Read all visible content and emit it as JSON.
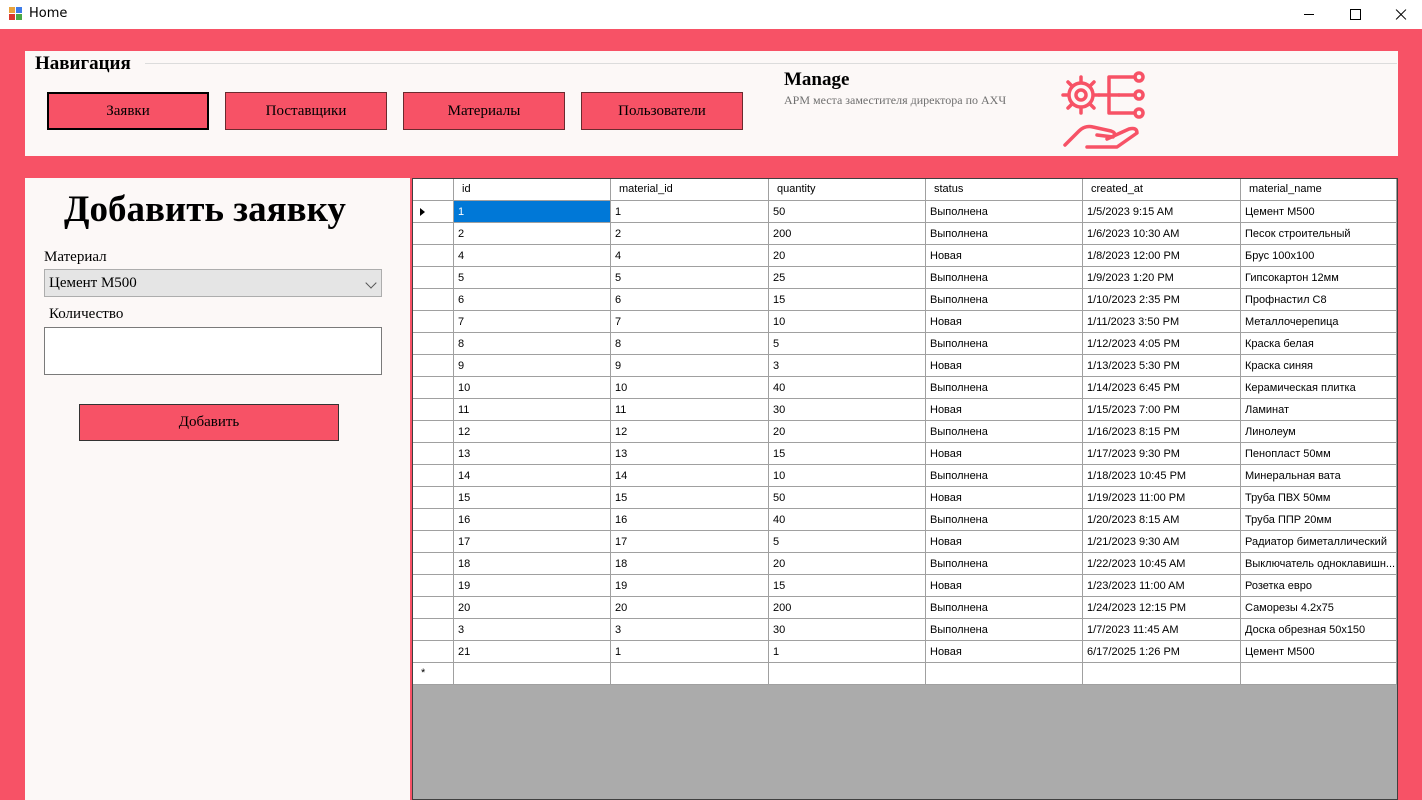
{
  "window": {
    "title": "Home"
  },
  "nav": {
    "legend": "Навигация",
    "buttons": [
      "Заявки",
      "Поставщики",
      "Материалы",
      "Пользователи"
    ]
  },
  "brand": {
    "title": "Manage",
    "subtitle": "АРМ места заместителя директора по АХЧ",
    "logo_icon": "gear-hand-network-icon"
  },
  "form": {
    "title": "Добавить заявку",
    "material_label": "Материал",
    "material_value": "Цемент М500",
    "quantity_label": "Количество",
    "quantity_value": "",
    "submit_label": "Добавить"
  },
  "grid": {
    "columns": [
      "id",
      "material_id",
      "quantity",
      "status",
      "created_at",
      "material_name"
    ],
    "rows": [
      [
        "1",
        "1",
        "50",
        "Выполнена",
        "1/5/2023 9:15 AM",
        "Цемент М500"
      ],
      [
        "2",
        "2",
        "200",
        "Выполнена",
        "1/6/2023 10:30 AM",
        "Песок строительный"
      ],
      [
        "4",
        "4",
        "20",
        "Новая",
        "1/8/2023 12:00 PM",
        "Брус 100х100"
      ],
      [
        "5",
        "5",
        "25",
        "Выполнена",
        "1/9/2023 1:20 PM",
        "Гипсокартон 12мм"
      ],
      [
        "6",
        "6",
        "15",
        "Выполнена",
        "1/10/2023 2:35 PM",
        "Профнастил С8"
      ],
      [
        "7",
        "7",
        "10",
        "Новая",
        "1/11/2023 3:50 PM",
        "Металлочерепица"
      ],
      [
        "8",
        "8",
        "5",
        "Выполнена",
        "1/12/2023 4:05 PM",
        "Краска белая"
      ],
      [
        "9",
        "9",
        "3",
        "Новая",
        "1/13/2023 5:30 PM",
        "Краска синяя"
      ],
      [
        "10",
        "10",
        "40",
        "Выполнена",
        "1/14/2023 6:45 PM",
        "Керамическая плитка"
      ],
      [
        "11",
        "11",
        "30",
        "Новая",
        "1/15/2023 7:00 PM",
        "Ламинат"
      ],
      [
        "12",
        "12",
        "20",
        "Выполнена",
        "1/16/2023 8:15 PM",
        "Линолеум"
      ],
      [
        "13",
        "13",
        "15",
        "Новая",
        "1/17/2023 9:30 PM",
        "Пенопласт 50мм"
      ],
      [
        "14",
        "14",
        "10",
        "Выполнена",
        "1/18/2023 10:45 PM",
        "Минеральная вата"
      ],
      [
        "15",
        "15",
        "50",
        "Новая",
        "1/19/2023 11:00 PM",
        "Труба ПВХ 50мм"
      ],
      [
        "16",
        "16",
        "40",
        "Выполнена",
        "1/20/2023 8:15 AM",
        "Труба ППР 20мм"
      ],
      [
        "17",
        "17",
        "5",
        "Новая",
        "1/21/2023 9:30 AM",
        "Радиатор биметаллический"
      ],
      [
        "18",
        "18",
        "20",
        "Выполнена",
        "1/22/2023 10:45 AM",
        "Выключатель одноклавишн..."
      ],
      [
        "19",
        "19",
        "15",
        "Новая",
        "1/23/2023 11:00 AM",
        "Розетка евро"
      ],
      [
        "20",
        "20",
        "200",
        "Выполнена",
        "1/24/2023 12:15 PM",
        "Саморезы 4.2х75"
      ],
      [
        "3",
        "3",
        "30",
        "Выполнена",
        "1/7/2023 11:45 AM",
        "Доска обрезная 50х150"
      ],
      [
        "21",
        "1",
        "1",
        "Новая",
        "6/17/2025 1:26 PM",
        "Цемент М500"
      ]
    ]
  },
  "colors": {
    "accent": "#f75266",
    "panel": "#fcf8f7",
    "selection": "#0078d7",
    "grid_background": "#ababab"
  }
}
